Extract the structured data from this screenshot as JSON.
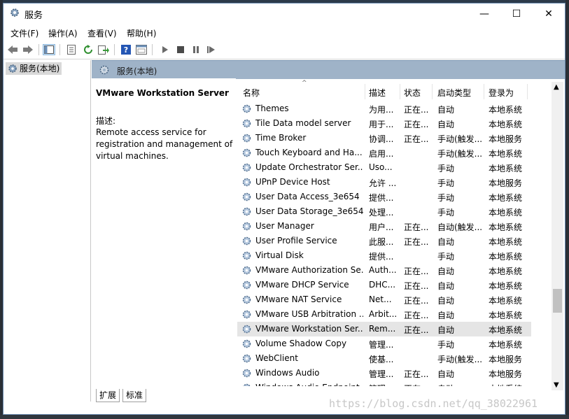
{
  "window": {
    "title": "服务",
    "minimize": "—",
    "maximize": "☐",
    "close": "✕"
  },
  "menu": [
    "文件(F)",
    "操作(A)",
    "查看(V)",
    "帮助(H)"
  ],
  "toolbar": [
    "back-icon",
    "forward-icon",
    "show-hide-tree-icon",
    "properties-icon",
    "refresh-icon",
    "export-icon",
    "help-icon",
    "view-icon",
    "start-icon",
    "stop-icon",
    "pause-icon",
    "restart-icon"
  ],
  "tree": {
    "item": "服务(本地)"
  },
  "panel": {
    "header": "服务(本地)"
  },
  "description": {
    "title": "VMware Workstation Server",
    "label": "描述:",
    "text": "Remote access service for registration and management of virtual machines."
  },
  "columns": [
    "名称",
    "描述",
    "状态",
    "启动类型",
    "登录为"
  ],
  "services": [
    {
      "name": "Themes",
      "desc": "为用...",
      "status": "正在...",
      "startup": "自动",
      "logon": "本地系统"
    },
    {
      "name": "Tile Data model server",
      "desc": "用于...",
      "status": "正在...",
      "startup": "自动",
      "logon": "本地系统"
    },
    {
      "name": "Time Broker",
      "desc": "协调...",
      "status": "正在...",
      "startup": "手动(触发...",
      "logon": "本地服务"
    },
    {
      "name": "Touch Keyboard and Ha...",
      "desc": "启用...",
      "status": "",
      "startup": "手动(触发...",
      "logon": "本地系统"
    },
    {
      "name": "Update Orchestrator Ser...",
      "desc": "Uso...",
      "status": "",
      "startup": "手动",
      "logon": "本地系统"
    },
    {
      "name": "UPnP Device Host",
      "desc": "允许 ...",
      "status": "",
      "startup": "手动",
      "logon": "本地服务"
    },
    {
      "name": "User Data Access_3e654",
      "desc": "提供...",
      "status": "",
      "startup": "手动",
      "logon": "本地系统"
    },
    {
      "name": "User Data Storage_3e654",
      "desc": "处理...",
      "status": "",
      "startup": "手动",
      "logon": "本地系统"
    },
    {
      "name": "User Manager",
      "desc": "用户...",
      "status": "正在...",
      "startup": "自动(触发...",
      "logon": "本地系统"
    },
    {
      "name": "User Profile Service",
      "desc": "此服...",
      "status": "正在...",
      "startup": "自动",
      "logon": "本地系统"
    },
    {
      "name": "Virtual Disk",
      "desc": "提供...",
      "status": "",
      "startup": "手动",
      "logon": "本地系统"
    },
    {
      "name": "VMware Authorization Se...",
      "desc": "Auth...",
      "status": "正在...",
      "startup": "自动",
      "logon": "本地系统"
    },
    {
      "name": "VMware DHCP Service",
      "desc": "DHC...",
      "status": "正在...",
      "startup": "自动",
      "logon": "本地系统"
    },
    {
      "name": "VMware NAT Service",
      "desc": "Net...",
      "status": "正在...",
      "startup": "自动",
      "logon": "本地系统"
    },
    {
      "name": "VMware USB Arbitration ...",
      "desc": "Arbit...",
      "status": "正在...",
      "startup": "自动",
      "logon": "本地系统"
    },
    {
      "name": "VMware Workstation Ser...",
      "desc": "Rem...",
      "status": "正在...",
      "startup": "自动",
      "logon": "本地系统"
    },
    {
      "name": "Volume Shadow Copy",
      "desc": "管理...",
      "status": "",
      "startup": "手动",
      "logon": "本地系统"
    },
    {
      "name": "WebClient",
      "desc": "使基...",
      "status": "",
      "startup": "手动(触发...",
      "logon": "本地服务"
    },
    {
      "name": "Windows Audio",
      "desc": "管理...",
      "status": "正在...",
      "startup": "自动",
      "logon": "本地服务"
    },
    {
      "name": "Windows Audio Endpoint...",
      "desc": "管理...",
      "status": "正在...",
      "startup": "自动",
      "logon": "本地系统"
    }
  ],
  "selected_index": 15,
  "tabs": [
    "扩展",
    "标准"
  ],
  "watermark": "https://blog.csdn.net/qq_38022961"
}
